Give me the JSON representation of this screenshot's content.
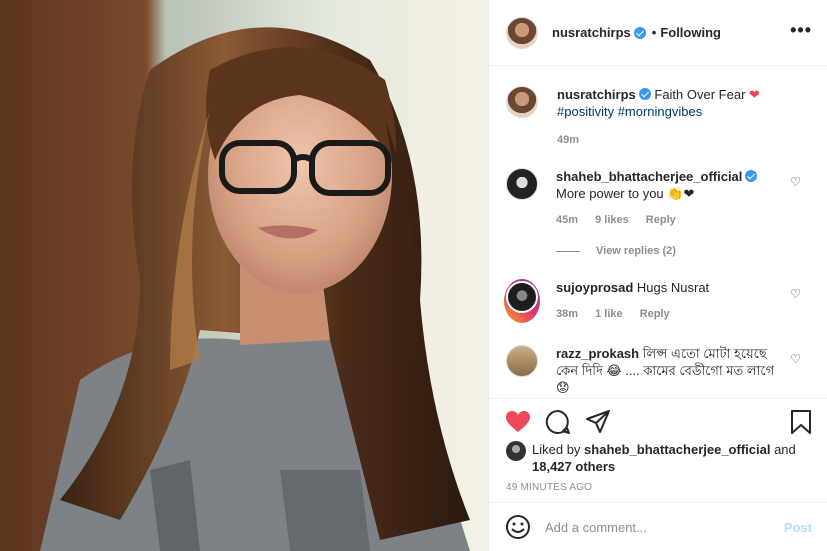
{
  "post": {
    "username": "nusratchirps",
    "following_label": "Following",
    "more_label": "•••",
    "caption_text": "Faith Over Fear",
    "caption_heart": "❤",
    "caption_tags": "#positivity #morningvibes",
    "caption_time": "49m"
  },
  "comments": [
    {
      "username": "shaheb_bhattacherjee_official",
      "text": "More power to you 👏❤",
      "time": "45m",
      "likes": "9 likes",
      "reply": "Reply",
      "view_replies": "View replies (2)"
    },
    {
      "username": "sujoyprosad",
      "text": "Hugs Nusrat",
      "time": "38m",
      "likes": "1 like",
      "reply": "Reply"
    },
    {
      "username": "razz_prokash",
      "text": "লিপ্স এতো মোটা হয়েছে কেন দিদি 😂 .... কামের বেডীগো মত লাগে 😟"
    }
  ],
  "actions": {
    "liked_prefix": "Liked by",
    "liked_user": "shaheb_bhattacherjee_official",
    "liked_suffix": "and",
    "liked_others": "18,427 others",
    "timeago": "49 MINUTES AGO"
  },
  "composer": {
    "placeholder": "Add a comment...",
    "post_label": "Post"
  },
  "colors": {
    "like_red": "#ed4956",
    "link_blue": "#00376b",
    "post_disabled": "#b2dffc",
    "verified_blue": "#3897f0"
  }
}
